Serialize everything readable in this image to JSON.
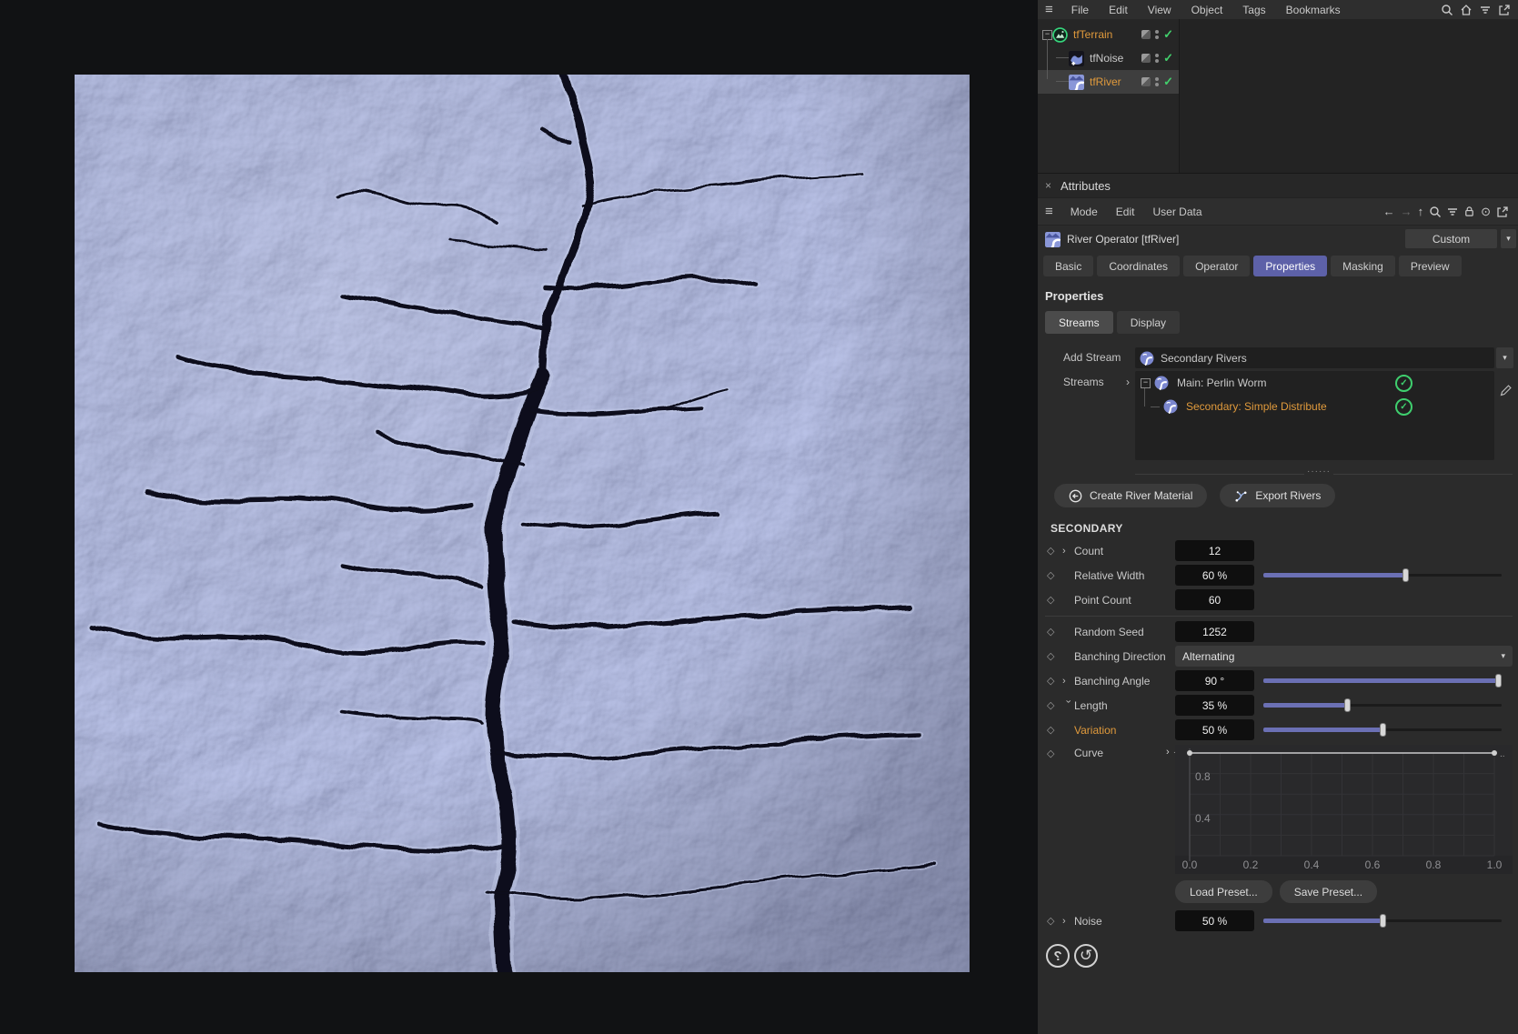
{
  "menubar": {
    "items": [
      "File",
      "Edit",
      "View",
      "Object",
      "Tags",
      "Bookmarks"
    ],
    "window_icons": [
      "search-icon",
      "home-icon",
      "filter-icon",
      "external-link-icon"
    ]
  },
  "object_tree": {
    "items": [
      {
        "name": "tfTerrain",
        "icon": "terrain-icon",
        "color": "orange",
        "depth": 0,
        "selected": false,
        "expander": true
      },
      {
        "name": "tfNoise",
        "icon": "noise-icon",
        "color": "white",
        "depth": 1,
        "selected": false,
        "expander": false
      },
      {
        "name": "tfRiver",
        "icon": "river-icon",
        "color": "orange",
        "depth": 1,
        "selected": true,
        "expander": false
      }
    ]
  },
  "attributes": {
    "title": "Attributes",
    "menu": [
      "Mode",
      "Edit",
      "User Data"
    ],
    "object_label": "River Operator [tfRiver]",
    "preset_dropdown": "Custom",
    "tabs": [
      "Basic",
      "Coordinates",
      "Operator",
      "Properties",
      "Masking",
      "Preview"
    ],
    "active_tab": "Properties",
    "section_heading": "Properties",
    "group_tabs": [
      "Streams",
      "Display"
    ],
    "active_group_tab": "Streams",
    "add_stream_label": "Add Stream",
    "add_stream_value": "Secondary Rivers",
    "streams_label": "Streams",
    "streams": [
      {
        "name": "Main: Perlin Worm",
        "icon": "stream-icon",
        "color": "white",
        "checked": true
      },
      {
        "name": "Secondary: Simple Distribute",
        "icon": "stream-icon",
        "color": "orange",
        "checked": true
      }
    ],
    "buttons": {
      "create": "Create River Material",
      "export": "Export Rivers"
    },
    "secondary_heading": "SECONDARY",
    "params": [
      {
        "label": "Count",
        "caret": "right",
        "value": "12",
        "type": "value"
      },
      {
        "label": "Relative Width",
        "value": "60 %",
        "type": "slider",
        "percent": 60
      },
      {
        "label": "Point Count",
        "value": "60",
        "type": "value"
      },
      {
        "label": "Random Seed",
        "value": "1252",
        "type": "value",
        "divider_before": true
      },
      {
        "label": "Banching Direction",
        "value": "Alternating",
        "type": "dropdown"
      },
      {
        "label": "Banching Angle",
        "caret": "right",
        "value": "90 °",
        "type": "slider",
        "percent": 100
      },
      {
        "label": "Length",
        "caret": "down",
        "value": "35 %",
        "type": "slider",
        "percent": 35
      },
      {
        "label": "Variation",
        "value": "50 %",
        "type": "slider",
        "percent": 50,
        "highlight": true
      },
      {
        "label": "Curve",
        "type": "curve"
      },
      {
        "label": "Noise",
        "caret": "right",
        "value": "50 %",
        "type": "slider",
        "percent": 50,
        "after_presets": true
      }
    ],
    "curve": {
      "chart_data": {
        "type": "line",
        "x": [
          0.0,
          1.0
        ],
        "y": [
          1.0,
          1.0
        ],
        "x_ticks": [
          "0.0",
          "0.2",
          "0.4",
          "0.6",
          "0.8",
          "1.0"
        ],
        "y_ticks": [
          "0.8",
          "0.4"
        ],
        "xlim": [
          0,
          1
        ],
        "ylim": [
          0,
          1.05
        ],
        "grid": true,
        "legend": false
      }
    },
    "presets": [
      "Load Preset...",
      "Save Preset..."
    ],
    "help_buttons": [
      "help-icon",
      "reset-icon"
    ]
  },
  "colors": {
    "accent_tab": "#5d61a8",
    "slider_fill": "#6b70b4",
    "highlight_text": "#e09a3c",
    "check_green": "#3fcf6e",
    "terrain_base": "#7d86b5",
    "river_channel": "#0a0d1a"
  }
}
